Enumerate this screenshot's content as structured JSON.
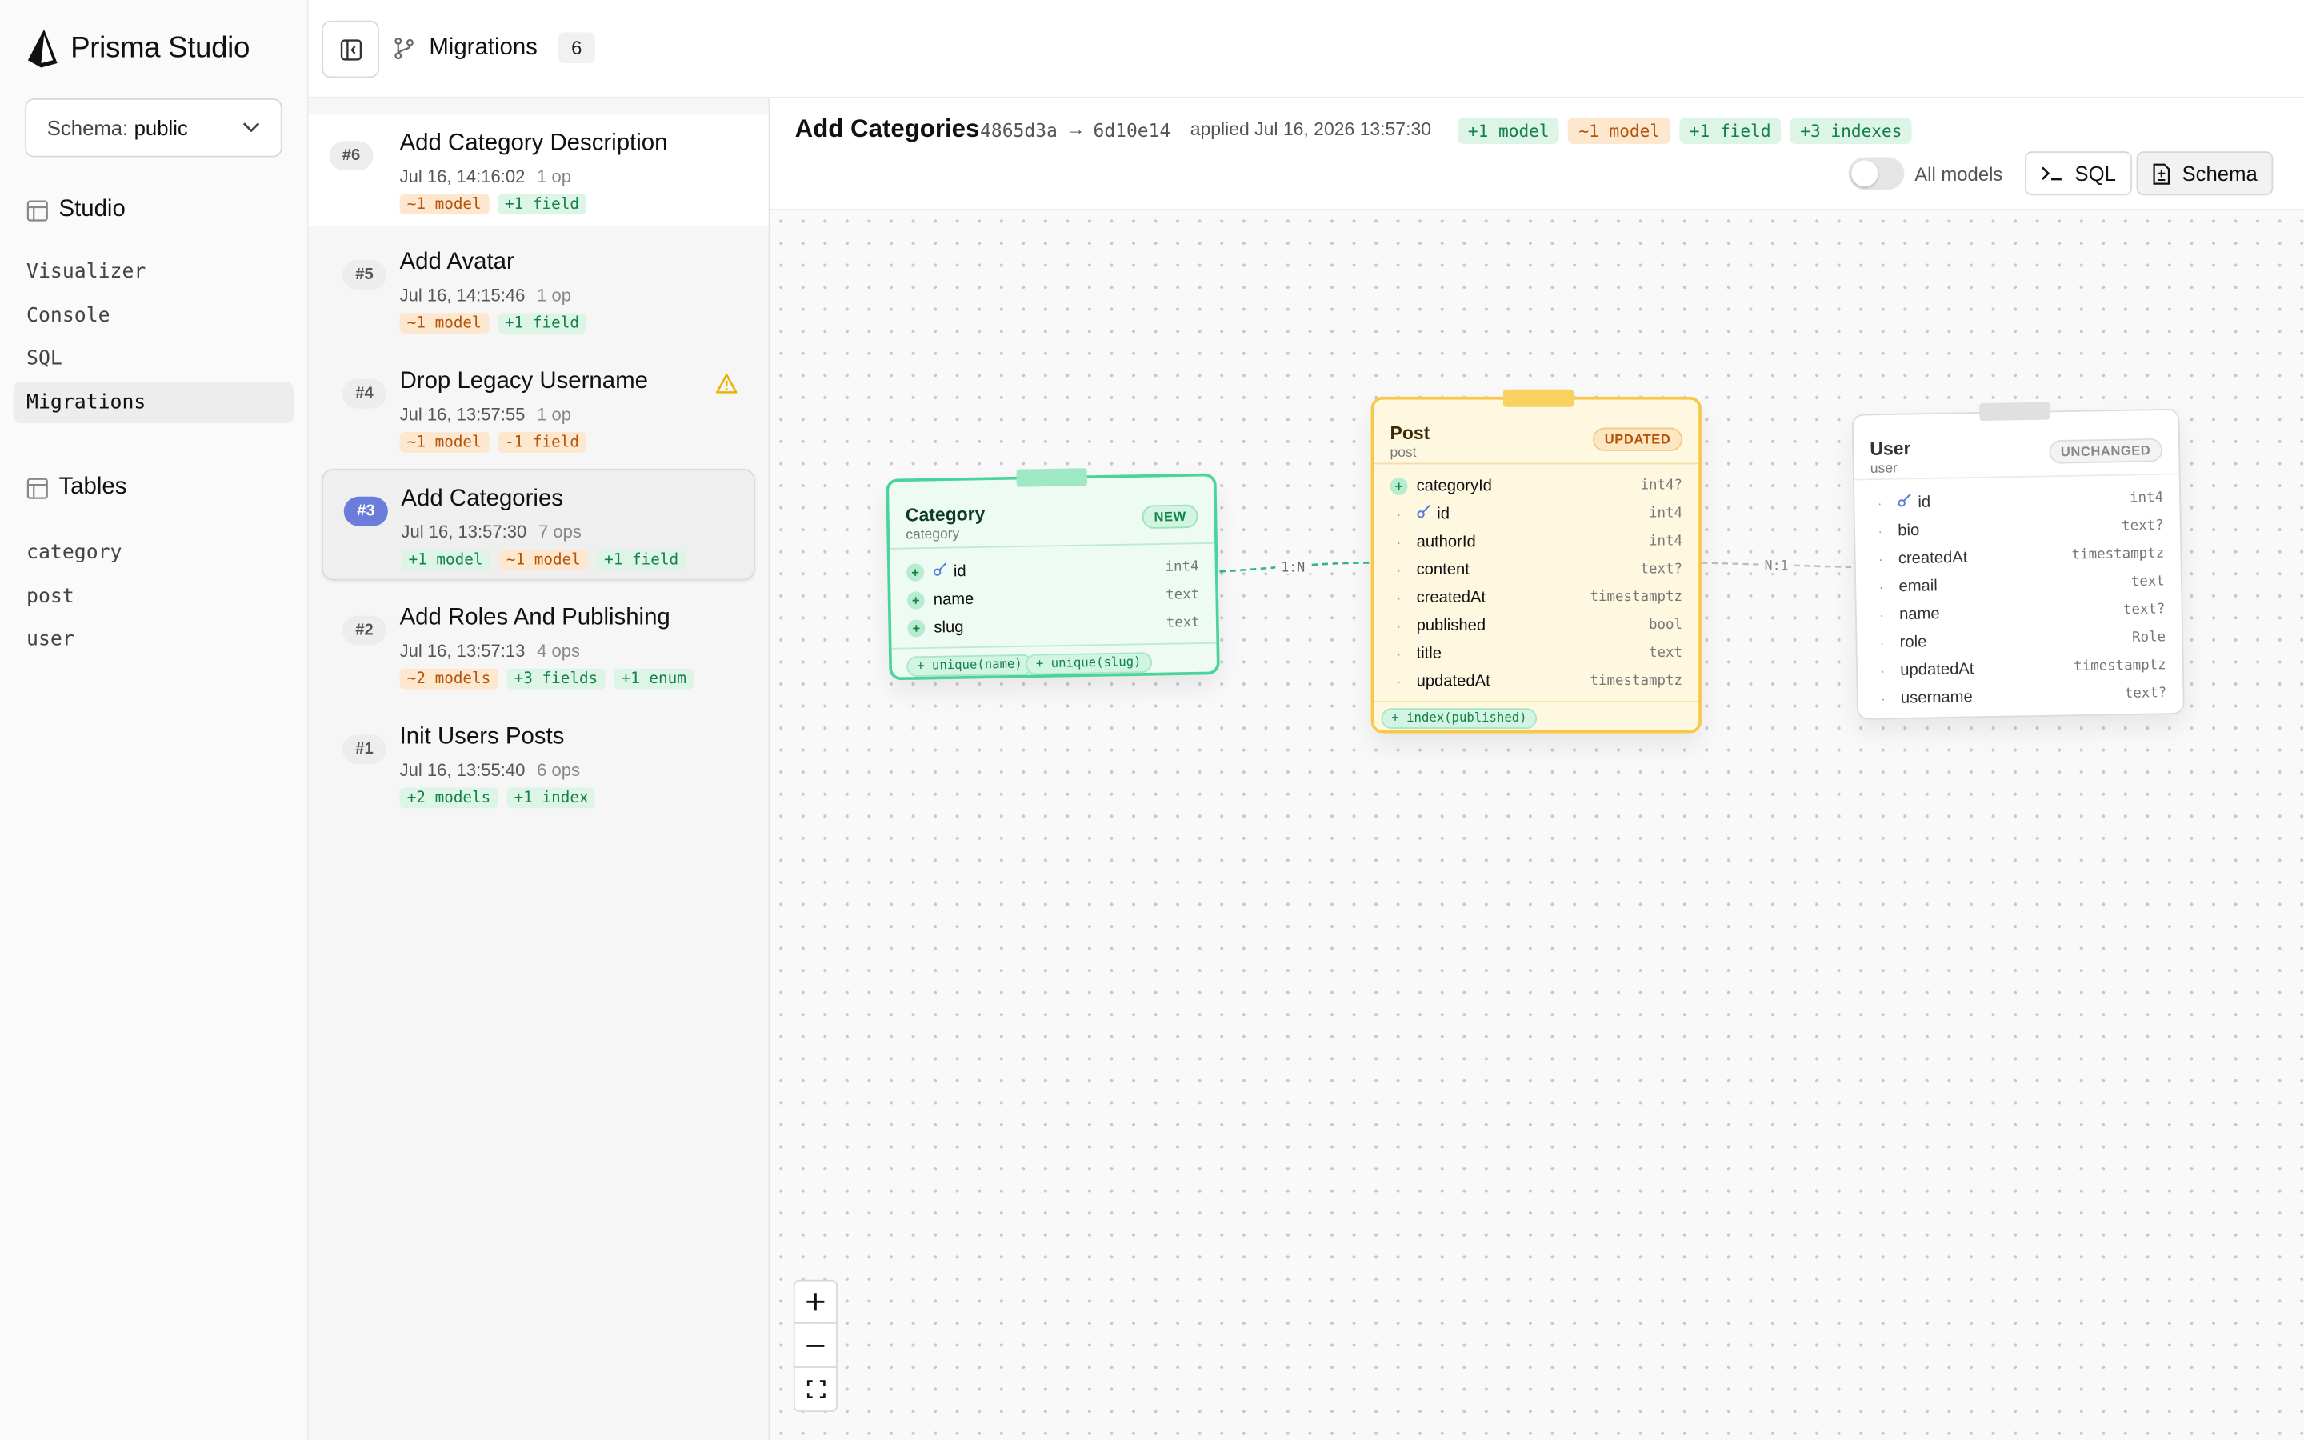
{
  "app": {
    "name": "Prisma Studio"
  },
  "schema": {
    "label": "Schema:",
    "value": "public"
  },
  "studio": {
    "title": "Studio",
    "items": [
      {
        "label": "Visualizer"
      },
      {
        "label": "Console"
      },
      {
        "label": "SQL"
      },
      {
        "label": "Migrations"
      }
    ]
  },
  "tables": {
    "title": "Tables",
    "items": [
      {
        "label": "category"
      },
      {
        "label": "post"
      },
      {
        "label": "user"
      }
    ]
  },
  "topbar": {
    "title": "Migrations",
    "count": "6"
  },
  "migrations": [
    {
      "num": "#6",
      "title": "Add Category Description",
      "time": "Jul 16, 14:16:02",
      "ops": "1 op",
      "tags": [
        {
          "text": "~1 model",
          "tone": "orange"
        },
        {
          "text": "+1 field",
          "tone": "green"
        }
      ]
    },
    {
      "num": "#5",
      "title": "Add Avatar",
      "time": "Jul 16, 14:15:46",
      "ops": "1 op",
      "tags": [
        {
          "text": "~1 model",
          "tone": "orange"
        },
        {
          "text": "+1 field",
          "tone": "green"
        }
      ]
    },
    {
      "num": "#4",
      "title": "Drop Legacy Username",
      "time": "Jul 16, 13:57:55",
      "ops": "1 op",
      "warning": true,
      "tags": [
        {
          "text": "~1 model",
          "tone": "orange"
        },
        {
          "text": "-1 field",
          "tone": "orange"
        }
      ]
    },
    {
      "num": "#3",
      "title": "Add Categories",
      "time": "Jul 16, 13:57:30",
      "ops": "7 ops",
      "selected": true,
      "tags": [
        {
          "text": "+1 model",
          "tone": "green"
        },
        {
          "text": "~1 model",
          "tone": "orange"
        },
        {
          "text": "+1 field",
          "tone": "green"
        }
      ]
    },
    {
      "num": "#2",
      "title": "Add Roles And Publishing",
      "time": "Jul 16, 13:57:13",
      "ops": "4 ops",
      "tags": [
        {
          "text": "~2 models",
          "tone": "orange"
        },
        {
          "text": "+3 fields",
          "tone": "green"
        },
        {
          "text": "+1 enum",
          "tone": "green"
        }
      ]
    },
    {
      "num": "#1",
      "title": "Init Users Posts",
      "time": "Jul 16, 13:55:40",
      "ops": "6 ops",
      "tags": [
        {
          "text": "+2 models",
          "tone": "green"
        },
        {
          "text": "+1 index",
          "tone": "green"
        }
      ]
    }
  ],
  "detail": {
    "title": "Add Categories",
    "from_hash": "4865d3a",
    "arrow": "→",
    "to_hash": "6d10e14",
    "applied": "applied Jul 16, 2026 13:57:30",
    "tags": [
      {
        "text": "+1 model",
        "tone": "green"
      },
      {
        "text": "~1 model",
        "tone": "orange"
      },
      {
        "text": "+1 field",
        "tone": "green"
      },
      {
        "text": "+3 indexes",
        "tone": "green"
      }
    ],
    "toggle_label": "All models",
    "sql_button": "SQL",
    "schema_button": "Schema"
  },
  "models": {
    "category": {
      "name": "Category",
      "table": "category",
      "status": "NEW",
      "fields": [
        {
          "name": "id",
          "type": "int4",
          "mark": "plus",
          "key": true
        },
        {
          "name": "name",
          "type": "text",
          "mark": "plus"
        },
        {
          "name": "slug",
          "type": "text",
          "mark": "plus"
        }
      ],
      "indexes": [
        "+ unique(name)",
        "+ unique(slug)"
      ]
    },
    "post": {
      "name": "Post",
      "table": "post",
      "status": "UPDATED",
      "fields": [
        {
          "name": "categoryId",
          "type": "int4?",
          "mark": "plus"
        },
        {
          "name": "id",
          "type": "int4",
          "mark": "dot",
          "key": true
        },
        {
          "name": "authorId",
          "type": "int4",
          "mark": "dot"
        },
        {
          "name": "content",
          "type": "text?",
          "mark": "dot"
        },
        {
          "name": "createdAt",
          "type": "timestamptz",
          "mark": "dot"
        },
        {
          "name": "published",
          "type": "bool",
          "mark": "dot"
        },
        {
          "name": "title",
          "type": "text",
          "mark": "dot"
        },
        {
          "name": "updatedAt",
          "type": "timestamptz",
          "mark": "dot"
        }
      ],
      "indexes": [
        "+ index(published)"
      ]
    },
    "user": {
      "name": "User",
      "table": "user",
      "status": "UNCHANGED",
      "fields": [
        {
          "name": "id",
          "type": "int4",
          "mark": "dot",
          "key": true
        },
        {
          "name": "bio",
          "type": "text?",
          "mark": "dot"
        },
        {
          "name": "createdAt",
          "type": "timestamptz",
          "mark": "dot"
        },
        {
          "name": "email",
          "type": "text",
          "mark": "dot"
        },
        {
          "name": "name",
          "type": "text?",
          "mark": "dot"
        },
        {
          "name": "role",
          "type": "Role",
          "mark": "dot"
        },
        {
          "name": "updatedAt",
          "type": "timestamptz",
          "mark": "dot"
        },
        {
          "name": "username",
          "type": "text?",
          "mark": "dot"
        }
      ]
    }
  },
  "relations": [
    {
      "label": "1:N"
    },
    {
      "label": "N:1"
    }
  ],
  "colors": {
    "new_border": "#4ad39a",
    "updated_border": "#f7c84b",
    "unchanged_border": "#dcdcdc",
    "selected_badge": "#6b7cdb",
    "warning": "#eab308"
  }
}
